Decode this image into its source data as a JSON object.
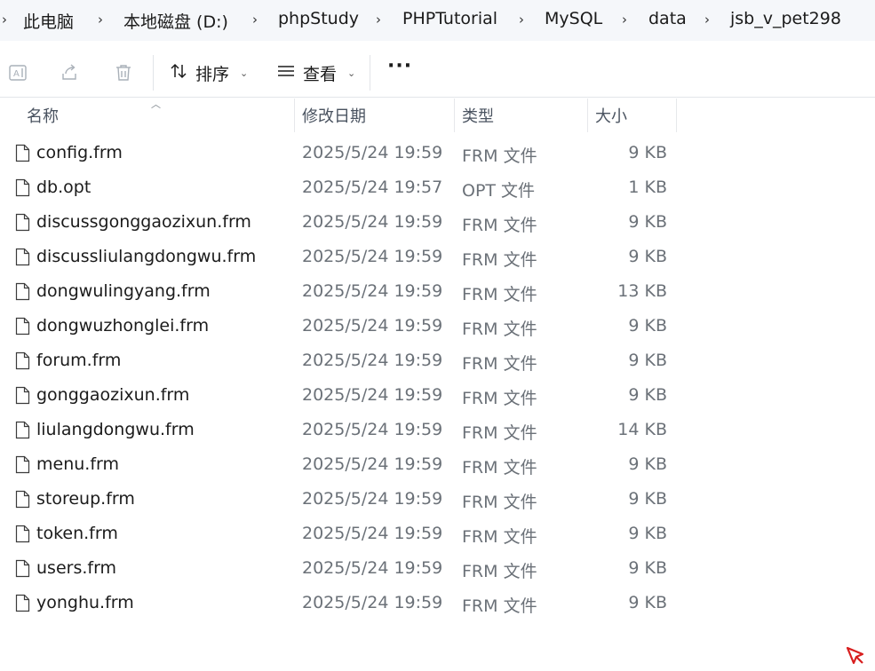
{
  "breadcrumb": {
    "items": [
      "此电脑",
      "本地磁盘 (D:)",
      "phpStudy",
      "PHPTutorial",
      "MySQL",
      "data",
      "jsb_v_pet298"
    ]
  },
  "toolbar": {
    "sort_label": "排序",
    "view_label": "查看",
    "more_label": "···"
  },
  "columns": {
    "name": "名称",
    "modified": "修改日期",
    "type": "类型",
    "size": "大小"
  },
  "files": [
    {
      "name": "config.frm",
      "modified": "2025/5/24 19:59",
      "type": "FRM 文件",
      "size": "9 KB"
    },
    {
      "name": "db.opt",
      "modified": "2025/5/24 19:57",
      "type": "OPT 文件",
      "size": "1 KB"
    },
    {
      "name": "discussgonggaozixun.frm",
      "modified": "2025/5/24 19:59",
      "type": "FRM 文件",
      "size": "9 KB"
    },
    {
      "name": "discussliulangdongwu.frm",
      "modified": "2025/5/24 19:59",
      "type": "FRM 文件",
      "size": "9 KB"
    },
    {
      "name": "dongwulingyang.frm",
      "modified": "2025/5/24 19:59",
      "type": "FRM 文件",
      "size": "13 KB"
    },
    {
      "name": "dongwuzhonglei.frm",
      "modified": "2025/5/24 19:59",
      "type": "FRM 文件",
      "size": "9 KB"
    },
    {
      "name": "forum.frm",
      "modified": "2025/5/24 19:59",
      "type": "FRM 文件",
      "size": "9 KB"
    },
    {
      "name": "gonggaozixun.frm",
      "modified": "2025/5/24 19:59",
      "type": "FRM 文件",
      "size": "9 KB"
    },
    {
      "name": "liulangdongwu.frm",
      "modified": "2025/5/24 19:59",
      "type": "FRM 文件",
      "size": "14 KB"
    },
    {
      "name": "menu.frm",
      "modified": "2025/5/24 19:59",
      "type": "FRM 文件",
      "size": "9 KB"
    },
    {
      "name": "storeup.frm",
      "modified": "2025/5/24 19:59",
      "type": "FRM 文件",
      "size": "9 KB"
    },
    {
      "name": "token.frm",
      "modified": "2025/5/24 19:59",
      "type": "FRM 文件",
      "size": "9 KB"
    },
    {
      "name": "users.frm",
      "modified": "2025/5/24 19:59",
      "type": "FRM 文件",
      "size": "9 KB"
    },
    {
      "name": "yonghu.frm",
      "modified": "2025/5/24 19:59",
      "type": "FRM 文件",
      "size": "9 KB"
    }
  ],
  "icons": {
    "file": "file-icon",
    "rename": "rename-icon",
    "share": "share-icon",
    "delete": "delete-icon",
    "sort": "sort-icon",
    "view": "view-icon"
  },
  "colors": {
    "breadcrumb_bg": "#f5f7fa",
    "text_primary": "#1b1b1b",
    "text_secondary": "#6b7178",
    "disabled_icon": "#a9b0b8"
  }
}
